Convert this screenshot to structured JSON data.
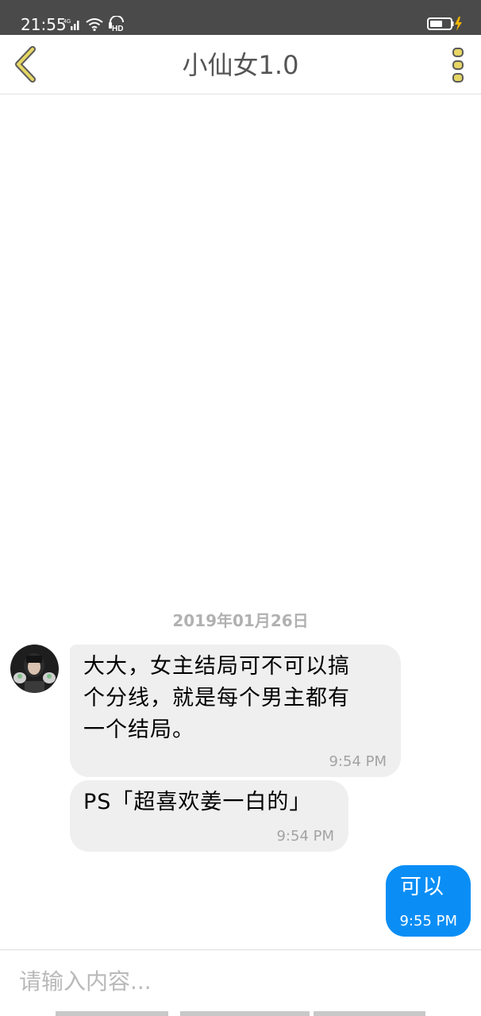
{
  "status_bar": {
    "time": "21:55",
    "network": "4G",
    "signal_icon": "signal-icon",
    "wifi_icon": "wifi-icon",
    "hd_label": "HD",
    "battery_icon": "battery-charging-icon"
  },
  "header": {
    "back_icon": "chevron-left-icon",
    "title": "小仙女1.0",
    "more_icon": "more-vertical-icon",
    "accent_color": "#d8c24a"
  },
  "chat": {
    "date_divider": "2019年01月26日",
    "messages": [
      {
        "direction": "incoming",
        "lines": [
          "大大，女主结局可不可以搞",
          "个分线，就是每个男主都有",
          "一个结局。"
        ],
        "time": "9:54 PM"
      },
      {
        "direction": "incoming",
        "lines": [
          "PS「超喜欢姜一白的」"
        ],
        "time": "9:54 PM"
      },
      {
        "direction": "outgoing",
        "lines": [
          "可以"
        ],
        "time": "9:55 PM"
      }
    ],
    "outgoing_color": "#0a8ef6",
    "incoming_color": "#efefef"
  },
  "input": {
    "placeholder": "请输入内容..."
  }
}
